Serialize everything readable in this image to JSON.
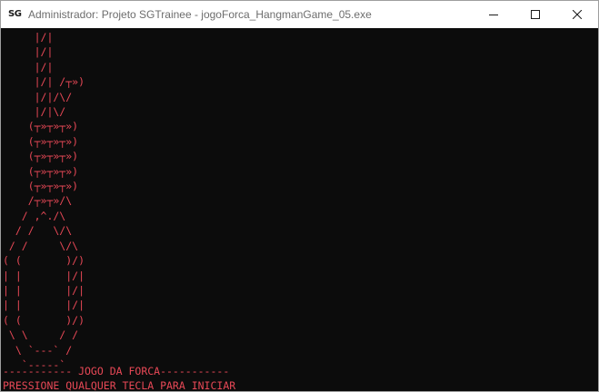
{
  "window": {
    "title": "Administrador: Projeto SGTrainee - jogoForca_HangmanGame_05.exe",
    "app_icon_label": "SG",
    "controls": [
      "minimize",
      "maximize",
      "close"
    ]
  },
  "console": {
    "text_color": "#e74856",
    "background": "#0c0c0c",
    "art_lines": [
      "     |/|",
      "     |/|",
      "     |/|",
      "     |/| /┬»)",
      "     |/|/\\/",
      "     |/|\\/",
      "    (┬»┬»┬»)",
      "    (┬»┬»┬»)",
      "    (┬»┬»┬»)",
      "    (┬»┬»┬»)",
      "    (┬»┬»┬»)",
      "    /┬»┬»/\\",
      "   / ,^./\\",
      "  / /   \\/\\",
      " / /     \\/\\",
      "( (       )/)",
      "| |       |/|",
      "| |       |/|",
      "| |       |/|",
      "( (       )/)",
      " \\ \\     / /",
      "  \\ `---` /",
      "   `-----`"
    ],
    "banner": "----------- JOGO DA FORCA-----------",
    "prompt": "PRESSIONE QUALQUER TECLA PARA INICIAR"
  }
}
